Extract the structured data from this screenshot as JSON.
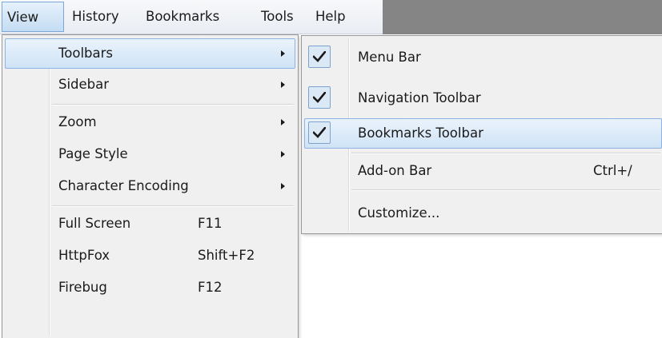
{
  "menubar": {
    "items": [
      {
        "label": "View",
        "active": true
      },
      {
        "label": "History",
        "active": false
      },
      {
        "label": "Bookmarks",
        "active": false
      },
      {
        "label": "Tools",
        "active": false
      },
      {
        "label": "Help",
        "active": false
      }
    ]
  },
  "view_menu": {
    "items": [
      {
        "label": "Toolbars",
        "submenu": true,
        "highlighted": true
      },
      {
        "label": "Sidebar",
        "submenu": true
      },
      {
        "label": "Zoom",
        "submenu": true
      },
      {
        "label": "Page Style",
        "submenu": true
      },
      {
        "label": "Character Encoding",
        "submenu": true
      },
      {
        "label": "Full Screen",
        "shortcut": "F11"
      },
      {
        "label": "HttpFox",
        "shortcut": "Shift+F2"
      },
      {
        "label": "Firebug",
        "shortcut": "F12"
      }
    ]
  },
  "toolbars_menu": {
    "items": [
      {
        "label": "Menu Bar",
        "checked": true
      },
      {
        "label": "Navigation Toolbar",
        "checked": true
      },
      {
        "label": "Bookmarks Toolbar",
        "checked": true,
        "highlighted": true
      },
      {
        "label": "Add-on Bar",
        "checked": false,
        "shortcut": "Ctrl+/"
      },
      {
        "label": "Customize...",
        "checked": false
      }
    ]
  },
  "icons": {
    "check": "check-icon",
    "submenu_arrow": "submenu-arrow-icon"
  },
  "colors": {
    "highlight_border": "#8db2e3",
    "highlight_fill": "#cfe3f6",
    "menu_bg": "#f0f0f0",
    "menubar_strip": "#858585"
  }
}
